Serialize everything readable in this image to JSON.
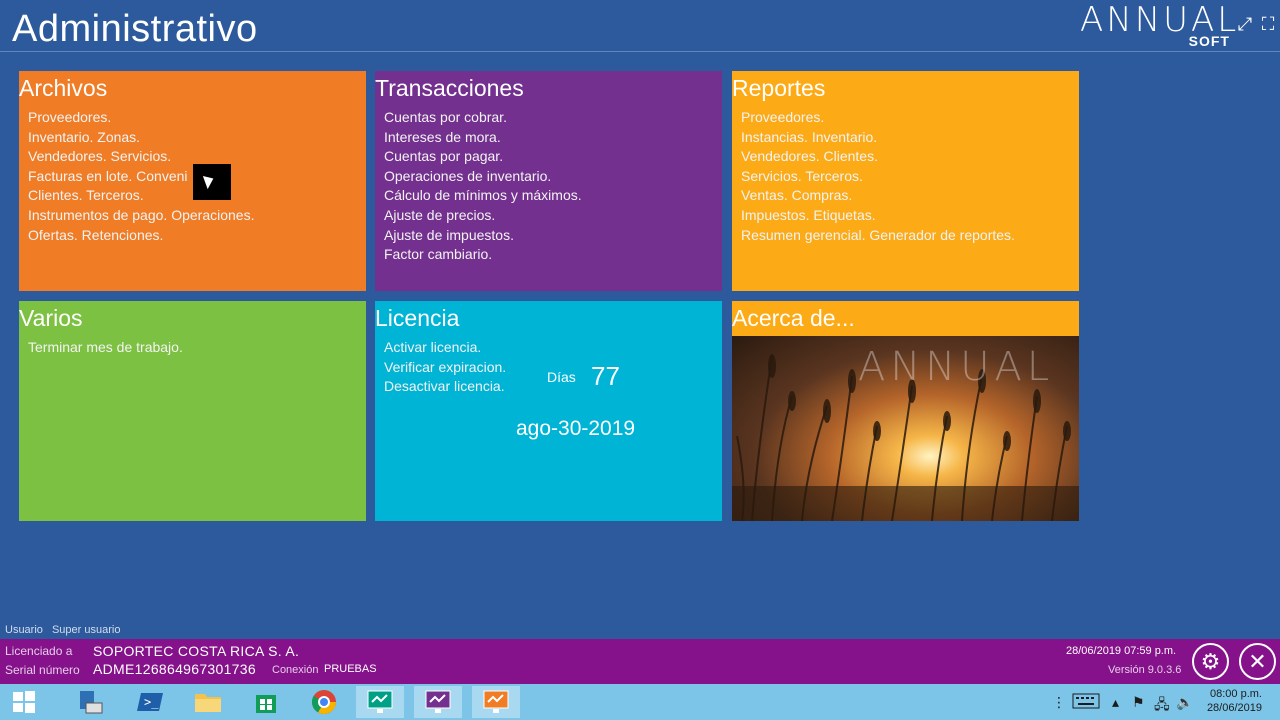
{
  "header": {
    "title": "Administrativo"
  },
  "logo": {
    "main": "ANNUAL",
    "sub": "SOFT"
  },
  "window_controls": {
    "expand_icon": "expand-icon",
    "fullscreen_icon": "fullscreen-icon"
  },
  "tiles": {
    "archivos": {
      "title": "Archivos",
      "color": "#f07c25",
      "items": [
        "Proveedores.",
        "Inventario. Zonas.",
        "Vendedores. Servicios.",
        "Facturas en lote. Conveni",
        "Clientes. Terceros.",
        "Instrumentos de pago. Operaciones.",
        "Ofertas. Retenciones."
      ]
    },
    "transacciones": {
      "title": "Transacciones",
      "color": "#73308f",
      "items": [
        "Cuentas por cobrar.",
        "Intereses de mora.",
        "Cuentas por pagar.",
        "Operaciones de inventario.",
        "Cálculo de mínimos y máximos.",
        "Ajuste de precios.",
        "Ajuste de impuestos.",
        "Factor cambiario."
      ]
    },
    "reportes": {
      "title": "Reportes",
      "color": "#fcaa15",
      "items": [
        "Proveedores.",
        "Instancias. Inventario.",
        "Vendedores. Clientes.",
        "Servicios. Terceros.",
        "Ventas. Compras.",
        "Impuestos. Etiquetas.",
        "Resumen gerencial. Generador de reportes."
      ]
    },
    "varios": {
      "title": "Varios",
      "color": "#7dc142",
      "items": [
        "Terminar mes de trabajo."
      ]
    },
    "licencia": {
      "title": "Licencia",
      "color": "#00b4d6",
      "items": [
        "Activar licencia.",
        "Verificar expiracion.",
        "Desactivar licencia."
      ],
      "dias_label": "Días",
      "dias_value": "77",
      "expiration": "ago-30-2019"
    },
    "acerca": {
      "title": "Acerca de...",
      "color": "#fcaa15",
      "watermark": "ANNUAL"
    }
  },
  "user": {
    "label": "Usuario",
    "value": "Super usuario"
  },
  "status": {
    "licensed_label": "Licenciado a",
    "licensed_value": "SOPORTEC COSTA RICA S. A.",
    "serial_label": "Serial número",
    "serial_value": "ADME126864967301736",
    "connection_label": "Conexión",
    "connection_value": "PRUEBAS",
    "datetime": "28/06/2019 07:59 p.m.",
    "version": "Versión 9.0.3.6"
  },
  "taskbar": {
    "time": "08:00 p.m.",
    "date": "28/06/2019",
    "apps": [
      "windows-start-icon",
      "file-explorer-server-icon",
      "powershell-icon",
      "folder-icon",
      "store-icon",
      "chrome-icon",
      "annual-app-teal-icon",
      "annual-app-purple-icon",
      "annual-app-orange-icon"
    ]
  }
}
